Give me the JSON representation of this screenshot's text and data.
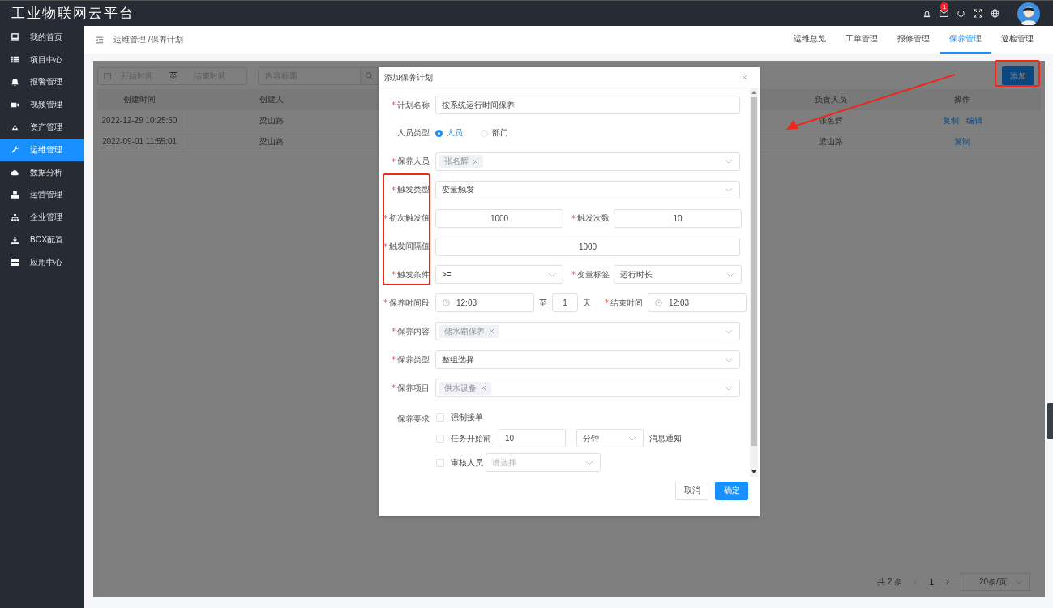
{
  "app": {
    "title": "工业物联网云平台",
    "mail_badge": "1"
  },
  "sidebar": {
    "items": [
      {
        "label": "我的首页",
        "selected": false
      },
      {
        "label": "项目中心",
        "selected": false
      },
      {
        "label": "报警管理",
        "selected": false
      },
      {
        "label": "视频管理",
        "selected": false
      },
      {
        "label": "资产管理",
        "selected": false
      },
      {
        "label": "运维管理",
        "selected": true
      },
      {
        "label": "数据分析",
        "selected": false
      },
      {
        "label": "运营管理",
        "selected": false
      },
      {
        "label": "企业管理",
        "selected": false
      },
      {
        "label": "BOX配置",
        "selected": false
      },
      {
        "label": "应用中心",
        "selected": false
      }
    ]
  },
  "header": {
    "breadcrumb": "运维管理 /保养计划",
    "tabs": [
      {
        "label": "运维总览",
        "selected": false
      },
      {
        "label": "工单管理",
        "selected": false
      },
      {
        "label": "报修管理",
        "selected": false
      },
      {
        "label": "保养管理",
        "selected": true
      },
      {
        "label": "巡检管理",
        "selected": false
      }
    ]
  },
  "filters": {
    "start_placeholder": "开始时间",
    "range_separator": "至",
    "end_placeholder": "结束时间",
    "search_placeholder": "内容标题"
  },
  "add_button": "添加",
  "table": {
    "columns": [
      "创建时间",
      "创建人",
      "负责人员",
      "操作"
    ],
    "rows": [
      {
        "cells": [
          "2022-12-29 10:25:50",
          "梁山路",
          "张名辉"
        ],
        "actions": [
          "复制",
          "编辑"
        ]
      },
      {
        "cells": [
          "2022-09-01 11:55:01",
          "梁山路",
          "梁山路"
        ],
        "actions": [
          "复制"
        ]
      }
    ]
  },
  "pagination": {
    "total": "共 2 条",
    "current_page": "1",
    "page_size": "20条/页"
  },
  "dialog": {
    "title": "添加保养计划",
    "form": {
      "rows": [
        {
          "kind": "field",
          "label": "计划名称",
          "required": true,
          "field": {
            "kind": "input",
            "value": "按系统运行时间保养"
          }
        },
        {
          "kind": "radio",
          "label": "人员类型",
          "options": [
            {
              "label": "人员",
              "selected": true
            },
            {
              "label": "部门",
              "selected": false
            }
          ]
        },
        {
          "kind": "field",
          "label": "保养人员",
          "required": true,
          "field": {
            "kind": "tags",
            "tags": [
              "张名辉"
            ]
          }
        },
        {
          "kind": "field",
          "label": "触发类型",
          "required": true,
          "field": {
            "kind": "select",
            "value": "变量触发"
          }
        },
        {
          "kind": "pair",
          "items": [
            {
              "label": "初次触发值",
              "required": true,
              "field": {
                "kind": "number",
                "value": "1000"
              }
            },
            {
              "label": "触发次数",
              "required": true,
              "field": {
                "kind": "number",
                "value": "10"
              }
            }
          ]
        },
        {
          "kind": "field",
          "label": "触发间隔值",
          "required": true,
          "field": {
            "kind": "number",
            "value": "1000"
          }
        },
        {
          "kind": "pair",
          "items": [
            {
              "label": "触发条件",
              "required": true,
              "field": {
                "kind": "select",
                "value": ">="
              }
            },
            {
              "label": "变量标签",
              "required": true,
              "field": {
                "kind": "select",
                "value": "运行时长"
              }
            }
          ]
        },
        {
          "kind": "time-range",
          "label": "保养时间段",
          "required": true,
          "start": "12:03",
          "separator": "至",
          "days": "1",
          "unit": "天",
          "end_label": "结束时间",
          "end_required": true,
          "end": "12:03"
        },
        {
          "kind": "field",
          "label": "保养内容",
          "required": true,
          "field": {
            "kind": "tags",
            "tags": [
              "储水箱保养"
            ]
          }
        },
        {
          "kind": "field",
          "label": "保养类型",
          "required": true,
          "field": {
            "kind": "select",
            "value": "整组选择"
          }
        },
        {
          "kind": "field",
          "label": "保养项目",
          "required": true,
          "field": {
            "kind": "tags",
            "tags": [
              "供水设备"
            ]
          }
        },
        {
          "kind": "requirements",
          "label": "保养要求",
          "options": [
            {
              "label": "强制接单",
              "checked": false
            },
            {
              "label": "任务开始前",
              "checked": false,
              "input": "10",
              "unit": "分钟",
              "suffix": "消息通知"
            },
            {
              "label": "审核人员",
              "checked": false,
              "placeholder": "请选择"
            }
          ]
        }
      ]
    },
    "buttons": [
      {
        "label": "取消",
        "kind": "default"
      },
      {
        "label": "确定",
        "kind": "primary"
      }
    ]
  }
}
